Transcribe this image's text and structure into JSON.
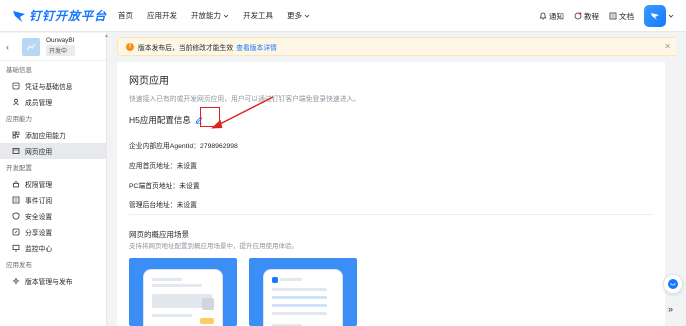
{
  "brand": {
    "name": "钉钉开放平台"
  },
  "nav": {
    "items": [
      {
        "label": "首页",
        "has_dropdown": false
      },
      {
        "label": "应用开发",
        "has_dropdown": false
      },
      {
        "label": "开放能力",
        "has_dropdown": true
      },
      {
        "label": "开发工具",
        "has_dropdown": false
      },
      {
        "label": "更多",
        "has_dropdown": true
      }
    ],
    "right": {
      "notice": "通知",
      "tutorial": "教程",
      "docs": "文档"
    }
  },
  "sidebar": {
    "app": {
      "name": "OurwayBI",
      "status": "开发中"
    },
    "sections": [
      {
        "title": "基础信息",
        "items": [
          {
            "label": "凭证与基础信息",
            "icon": "credential-icon"
          },
          {
            "label": "成员管理",
            "icon": "member-icon"
          }
        ]
      },
      {
        "title": "应用能力",
        "items": [
          {
            "label": "添加应用能力",
            "icon": "add-ability-icon"
          },
          {
            "label": "网页应用",
            "icon": "web-app-icon",
            "active": true
          }
        ]
      },
      {
        "title": "开发配置",
        "items": [
          {
            "label": "权限管理",
            "icon": "permission-icon"
          },
          {
            "label": "事件订阅",
            "icon": "event-icon"
          },
          {
            "label": "安全设置",
            "icon": "shield-icon"
          },
          {
            "label": "分享设置",
            "icon": "share-icon"
          },
          {
            "label": "监控中心",
            "icon": "monitor-icon"
          }
        ]
      },
      {
        "title": "应用发布",
        "items": [
          {
            "label": "版本管理与发布",
            "icon": "version-icon"
          }
        ]
      }
    ]
  },
  "notice": {
    "text": "版本发布后，当前修改才能生效",
    "link": "查看版本详情"
  },
  "main": {
    "title": "网页应用",
    "description": "快速接入已有的或开发网页应用，用户可以通过钉钉客户端免登录快速进入。",
    "h5_title": "H5应用配置信息",
    "fields": [
      {
        "label": "企业内部应用AgentId：",
        "value": "2798962998"
      },
      {
        "label": "应用首页地址：",
        "value": "未设置"
      },
      {
        "label": "PC端首页地址：",
        "value": "未设置"
      },
      {
        "label": "管理后台地址：",
        "value": "未设置"
      }
    ],
    "scenario": {
      "title": "网页的概应用场景",
      "description": "支持将网页地址配置到概应用场景中，提升应用使用体验。"
    }
  },
  "colors": {
    "brand": "#1677ff",
    "annotation": "#e02020",
    "notice_bg": "#fff7e6",
    "card_bg": "#3a8ef5"
  }
}
